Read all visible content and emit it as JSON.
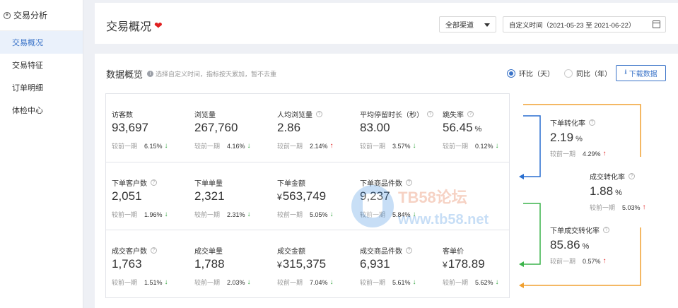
{
  "sidebar": {
    "header": "交易分析",
    "items": [
      {
        "label": "交易概况",
        "active": true
      },
      {
        "label": "交易特征",
        "active": false
      },
      {
        "label": "订单明细",
        "active": false
      },
      {
        "label": "体检中心",
        "active": false
      }
    ]
  },
  "header": {
    "title": "交易概况",
    "channel": "全部渠道",
    "date_range": "自定义时间（2021-05-23 至 2021-06-22）"
  },
  "overview": {
    "title": "数据概览",
    "info": "选择自定义时间，指标按天累加，暂不去重",
    "radio_day": "环比（天）",
    "radio_year": "同比（年）",
    "download": "下载数据"
  },
  "compare_label": "较前一期",
  "metrics": [
    [
      {
        "label": "访客数",
        "value": "93,697",
        "pct": "6.15%",
        "dir": "down",
        "help": false
      },
      {
        "label": "浏览量",
        "value": "267,760",
        "pct": "4.16%",
        "dir": "down",
        "help": false
      },
      {
        "label": "人均浏览量",
        "value": "2.86",
        "pct": "2.14%",
        "dir": "up",
        "help": true
      },
      {
        "label": "平均停留时长（秒）",
        "value": "83.00",
        "pct": "3.57%",
        "dir": "down",
        "help": true
      },
      {
        "label": "跳失率",
        "value": "56.45",
        "unit": "%",
        "pct": "0.12%",
        "dir": "down",
        "help": true
      }
    ],
    [
      {
        "label": "下单客户数",
        "value": "2,051",
        "pct": "1.96%",
        "dir": "down",
        "help": true
      },
      {
        "label": "下单单量",
        "value": "2,321",
        "pct": "2.31%",
        "dir": "down",
        "help": false
      },
      {
        "label": "下单金额",
        "value": "563,749",
        "currency": "¥",
        "pct": "5.05%",
        "dir": "down",
        "help": false
      },
      {
        "label": "下单商品件数",
        "value": "9,237",
        "pct": "5.84%",
        "dir": "down",
        "help": true
      }
    ],
    [
      {
        "label": "成交客户数",
        "value": "1,763",
        "pct": "1.51%",
        "dir": "down",
        "help": true
      },
      {
        "label": "成交单量",
        "value": "1,788",
        "pct": "2.03%",
        "dir": "down",
        "help": false
      },
      {
        "label": "成交金额",
        "value": "315,375",
        "currency": "¥",
        "pct": "7.04%",
        "dir": "down",
        "help": false
      },
      {
        "label": "成交商品件数",
        "value": "6,931",
        "pct": "5.61%",
        "dir": "down",
        "help": true
      },
      {
        "label": "客单价",
        "value": "178.89",
        "currency": "¥",
        "pct": "5.62%",
        "dir": "down",
        "help": false
      }
    ]
  ],
  "funnel": [
    {
      "label": "下单转化率",
      "value": "2.19",
      "unit": "%",
      "pct": "4.29%",
      "dir": "up"
    },
    {
      "label": "成交转化率",
      "value": "1.88",
      "unit": "%",
      "pct": "5.03%",
      "dir": "up"
    },
    {
      "label": "下单成交转化率",
      "value": "85.86",
      "unit": "%",
      "pct": "0.57%",
      "dir": "up"
    }
  ],
  "watermark": {
    "line1": "TB58论坛",
    "line2": "www.tb58.net"
  },
  "colors": {
    "accent": "#3a73c8",
    "up": "#e02020",
    "down": "#2fa33b",
    "orange": "#f0a030",
    "green_line": "#3cb44b"
  }
}
